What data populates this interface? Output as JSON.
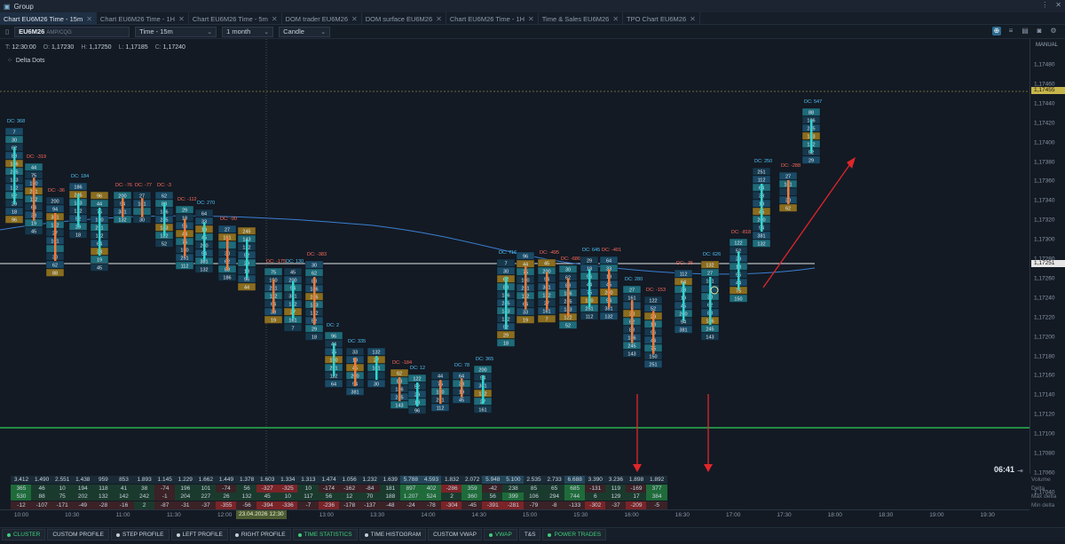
{
  "window": {
    "title": "Group",
    "controls": [
      "⋮",
      "✕"
    ]
  },
  "tabs": [
    {
      "label": "Chart EU6M26 Time - 15m",
      "active": true
    },
    {
      "label": "Chart EU6M26 Time - 1H",
      "active": false
    },
    {
      "label": "Chart EU6M26 Time - 5m",
      "active": false
    },
    {
      "label": "DOM trader EU6M26",
      "active": false
    },
    {
      "label": "DOM surface EU6M26",
      "active": false
    },
    {
      "label": "Chart EU6M26 Time - 1H",
      "active": false
    },
    {
      "label": "Time & Sales EU6M26",
      "active": false
    },
    {
      "label": "TPO Chart EU6M26",
      "active": false
    }
  ],
  "toolbar": {
    "symbol": "EU6M26",
    "feed": "AMP/CQG",
    "timeframe": "Time - 15m",
    "range": "1 month",
    "style": "Candle"
  },
  "ohlc": {
    "t_label": "T:",
    "t": "12:30:00",
    "o_label": "O:",
    "o": "1,17230",
    "h_label": "H:",
    "h": "1,17250",
    "l_label": "L:",
    "l": "1,17185",
    "c_label": "C:",
    "c": "1,17240"
  },
  "indicator": {
    "name": "Delta Dots"
  },
  "yaxis": {
    "mode": "MANUAL",
    "ticks": [
      "1,17480",
      "1,17460",
      "1,17440",
      "1,17420",
      "1,17400",
      "1,17380",
      "1,17360",
      "1,17340",
      "1,17320",
      "1,17300",
      "1,17280",
      "1,17260",
      "1,17240",
      "1,17220",
      "1,17200",
      "1,17180",
      "1,17160",
      "1,17140",
      "1,17120",
      "1,17100",
      "1,17080",
      "1,17060",
      "1,17040"
    ],
    "tag_high": "1,17455",
    "tag_last": "1,17251"
  },
  "timer": "06:41",
  "stats": {
    "labels": [
      "Volume",
      "Delta",
      "Max delta",
      "Min delta"
    ],
    "volume": [
      "3.412",
      "1.490",
      "2.551",
      "1.438",
      "959",
      "853",
      "1.893",
      "1.145",
      "1.229",
      "1.662",
      "1.449",
      "1.378",
      "1.603",
      "1.334",
      "1.313",
      "1.474",
      "1.056",
      "1.232",
      "1.639",
      "5.788",
      "4.593",
      "1.832",
      "2.072",
      "5.948",
      "5.100",
      "2.535",
      "2.733",
      "6.688",
      "3.390",
      "3.236",
      "1.898",
      "1.892"
    ],
    "delta": [
      "365",
      "46",
      "10",
      "194",
      "118",
      "41",
      "38",
      "-74",
      "196",
      "101",
      "-74",
      "56",
      "-327",
      "-325",
      "10",
      "-174",
      "-162",
      "-84",
      "181",
      "897",
      "402",
      "-286",
      "359",
      "-42",
      "238",
      "85",
      "65",
      "685",
      "-131",
      "119",
      "-169",
      "377"
    ],
    "max_delta": [
      "530",
      "88",
      "75",
      "202",
      "132",
      "142",
      "242",
      "-1",
      "204",
      "227",
      "26",
      "132",
      "45",
      "10",
      "117",
      "56",
      "12",
      "70",
      "188",
      "1.207",
      "524",
      "2",
      "360",
      "56",
      "399",
      "106",
      "294",
      "744",
      "6",
      "129",
      "17",
      "384"
    ],
    "min_delta": [
      "-12",
      "-107",
      "-171",
      "-49",
      "-28",
      "-16",
      "2",
      "-87",
      "-31",
      "-37",
      "-355",
      "-56",
      "-394",
      "-336",
      "-7",
      "-236",
      "-178",
      "-137",
      "-48",
      "-24",
      "-78",
      "-304",
      "-45",
      "-391",
      "-281",
      "-79",
      "-8",
      "-133",
      "-302",
      "-37",
      "-209",
      "-5"
    ]
  },
  "time_axis": [
    "10:00",
    "10:30",
    "11:00",
    "11:30",
    "12:00",
    "12:30",
    "13:00",
    "13:30",
    "14:00",
    "14:30",
    "15:00",
    "15:30",
    "16:00",
    "16:30",
    "17:00",
    "17:30",
    "18:00",
    "18:30",
    "19:00",
    "19:30"
  ],
  "date_flag": "23.04.2026 12:30",
  "dc_labels": [
    {
      "t": "DC: 368",
      "c": "#4fc3f7"
    },
    {
      "t": "DC: -319",
      "c": "#ff6b5a"
    },
    {
      "t": "DC: -36",
      "c": "#ff6b5a"
    },
    {
      "t": "DC: 184",
      "c": "#4fc3f7"
    },
    {
      "t": "DC: -76",
      "c": "#ff6b5a"
    },
    {
      "t": "DC: -77",
      "c": "#ff6b5a"
    },
    {
      "t": "DC: -3",
      "c": "#ff6b5a"
    },
    {
      "t": "DC: -112",
      "c": "#ff6b5a"
    },
    {
      "t": "DC: 270",
      "c": "#4fc3f7"
    },
    {
      "t": "DC: -90",
      "c": "#ff6b5a"
    },
    {
      "t": "DC: -175",
      "c": "#ff6b5a"
    },
    {
      "t": "DC: 130",
      "c": "#4fc3f7"
    },
    {
      "t": "DC: -383",
      "c": "#ff6b5a"
    },
    {
      "t": "DC: 2",
      "c": "#4fc3f7"
    },
    {
      "t": "DC: 335",
      "c": "#4fc3f7"
    },
    {
      "t": "DC: -184",
      "c": "#ff6b5a"
    },
    {
      "t": "DC: 12",
      "c": "#4fc3f7"
    },
    {
      "t": "DC: 78",
      "c": "#4fc3f7"
    },
    {
      "t": "DC: 365",
      "c": "#4fc3f7"
    },
    {
      "t": "DC: 716",
      "c": "#4fc3f7"
    },
    {
      "t": "DC: -495",
      "c": "#ff6b5a"
    },
    {
      "t": "DC: -686",
      "c": "#ff6b5a"
    },
    {
      "t": "DC: 645",
      "c": "#4fc3f7"
    },
    {
      "t": "DC: -401",
      "c": "#ff6b5a"
    },
    {
      "t": "DC: 280",
      "c": "#4fc3f7"
    },
    {
      "t": "DC: -153",
      "c": "#ff6b5a"
    },
    {
      "t": "DC: -35",
      "c": "#ff6b5a"
    },
    {
      "t": "DC: 626",
      "c": "#4fc3f7"
    },
    {
      "t": "DC: -818",
      "c": "#ff6b5a"
    },
    {
      "t": "DC: 250",
      "c": "#4fc3f7"
    },
    {
      "t": "DC: -288",
      "c": "#ff6b5a"
    },
    {
      "t": "DC: 547",
      "c": "#4fc3f7"
    }
  ],
  "bottom_buttons": [
    {
      "label": "CLUSTER",
      "on": true,
      "dot": "#3fd07a"
    },
    {
      "label": "CUSTOM PROFILE",
      "on": false,
      "dot": ""
    },
    {
      "label": "STEP PROFILE",
      "on": false,
      "dot": "#c5cfda"
    },
    {
      "label": "LEFT PROFILE",
      "on": false,
      "dot": "#c5cfda"
    },
    {
      "label": "RIGHT PROFILE",
      "on": false,
      "dot": "#c5cfda"
    },
    {
      "label": "TIME STATISTICS",
      "on": true,
      "dot": "#3fd07a"
    },
    {
      "label": "TIME HISTOGRAM",
      "on": false,
      "dot": "#c5cfda"
    },
    {
      "label": "CUSTOM VWAP",
      "on": false,
      "dot": ""
    },
    {
      "label": "VWAP",
      "on": true,
      "dot": "#3fd07a"
    },
    {
      "label": "T&S",
      "on": false,
      "dot": ""
    },
    {
      "label": "POWER TRADES",
      "on": true,
      "dot": "#3fd07a"
    }
  ],
  "colors": {
    "bg": "#131a24",
    "up": "#2fd6d0",
    "down": "#f07a3a",
    "cell_blue": "#1a4a66",
    "cell_teal": "#1e6b7a",
    "cell_gold": "#8a6d1e",
    "vwap": "#3b7fd0",
    "level": "#e6e6e6",
    "green_line": "#2ed15a",
    "high_line": "#c7b54a",
    "arrow": "#e0262a"
  }
}
